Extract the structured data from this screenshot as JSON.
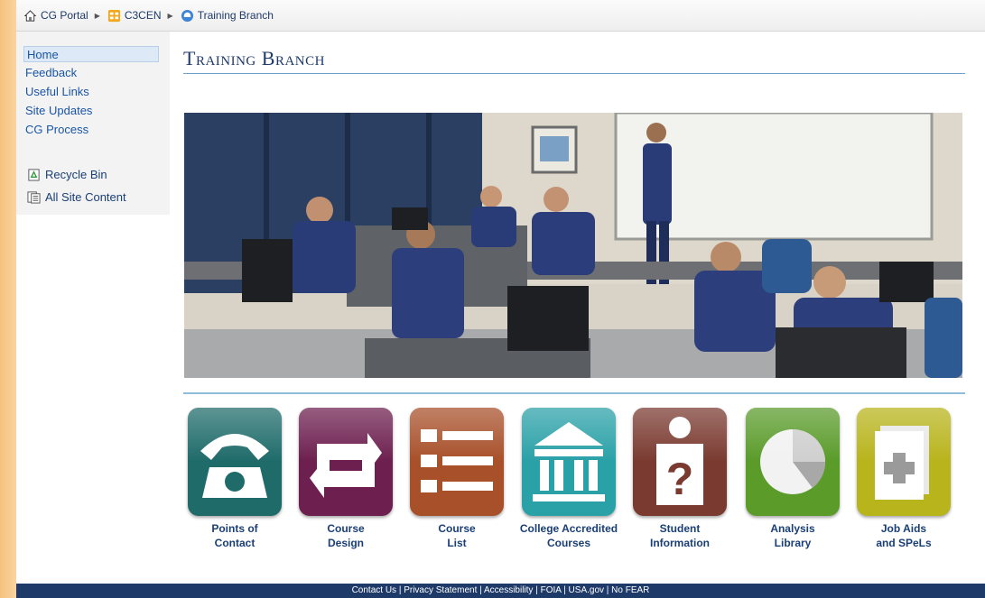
{
  "breadcrumb": {
    "items": [
      "CG Portal",
      "C3CEN",
      "Training Branch"
    ]
  },
  "sidebar": {
    "nav": [
      "Home",
      "Feedback",
      "Useful Links",
      "Site Updates",
      "CG Process"
    ],
    "utility": [
      "Recycle Bin",
      "All Site Content"
    ]
  },
  "main": {
    "title": "Training Branch",
    "tiles": [
      {
        "line1": "Points of",
        "line2": "Contact",
        "icon": "telephone-icon",
        "color": "#1e6b6a"
      },
      {
        "line1": "Course",
        "line2": "Design",
        "icon": "cycle-arrows-icon",
        "color": "#6d1f4f"
      },
      {
        "line1": "Course",
        "line2": "List",
        "icon": "list-icon",
        "color": "#a8502a"
      },
      {
        "line1": "College Accredited",
        "line2": "Courses",
        "icon": "institution-icon",
        "color": "#2aa1a7"
      },
      {
        "line1": "Student",
        "line2": "Information",
        "icon": "question-badge-icon",
        "color": "#7a3a30"
      },
      {
        "line1": "Analysis",
        "line2": "Library",
        "icon": "pie-chart-icon",
        "color": "#5a9b2a"
      },
      {
        "line1": "Job Aids",
        "line2": "and SPeLs",
        "icon": "add-document-icon",
        "color": "#b8b41c"
      }
    ]
  },
  "footer": {
    "links": [
      "Contact Us",
      "Privacy Statement",
      "Accessibility",
      "FOIA",
      "USA.gov",
      "No FEAR"
    ]
  }
}
